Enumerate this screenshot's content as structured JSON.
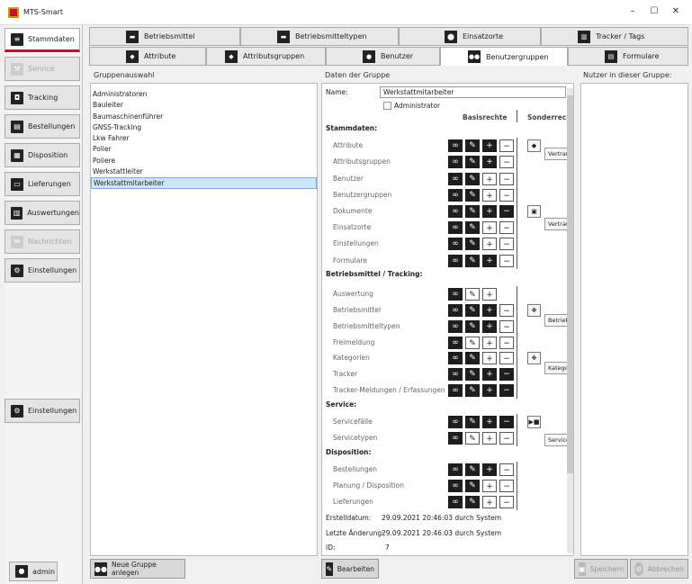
{
  "window": {
    "title": "MTS-Smart",
    "min": "–",
    "max": "☐",
    "close": "✕"
  },
  "sidebar": {
    "items": [
      {
        "label": "Stammdaten",
        "icon": "list-icon",
        "active": true
      },
      {
        "label": "Service",
        "icon": "wrench-icon",
        "disabled": true
      },
      {
        "label": "Tracking",
        "icon": "tracking-icon"
      },
      {
        "label": "Bestellungen",
        "icon": "order-icon"
      },
      {
        "label": "Disposition",
        "icon": "disposition-icon"
      },
      {
        "label": "Lieferungen",
        "icon": "delivery-icon"
      },
      {
        "label": "Auswertungen",
        "icon": "chart-icon"
      },
      {
        "label": "Nachrichten",
        "icon": "mail-icon",
        "disabled": true
      },
      {
        "label": "Einstellungen",
        "icon": "gear-icon"
      }
    ],
    "settings": "Einstellungen",
    "user": "admin"
  },
  "tabs_row1": [
    {
      "label": "Betriebsmittel"
    },
    {
      "label": "Betriebsmitteltypen"
    },
    {
      "label": "Einsatzorte"
    },
    {
      "label": "Tracker / Tags"
    }
  ],
  "tabs_row2": [
    {
      "label": "Attribute"
    },
    {
      "label": "Attributsgruppen"
    },
    {
      "label": "Benutzer"
    },
    {
      "label": "Benutzergruppen"
    },
    {
      "label": "Formulare"
    }
  ],
  "groups": {
    "header": "Gruppenauswahl",
    "items": [
      "Administratoren",
      "Bauleiter",
      "Baumaschinenführer",
      "GNSS-Tracking",
      "Lkw Fahrer",
      "Polier",
      "Poliere",
      "Werkstattleiter",
      "Werkstattmitarbeiter"
    ],
    "selected": 8,
    "new_button": "Neue Gruppe anlegen"
  },
  "details": {
    "header": "Daten der Gruppe",
    "name_label": "Name:",
    "name_value": "Werkstattmitarbeiter",
    "admin_label": "Administrator",
    "col_basic": "Basisrechte",
    "col_special": "Sonderrech",
    "sections": [
      {
        "title": "Stammdaten:",
        "rows": [
          "Attribute",
          "Attributsgruppen",
          "Benutzer",
          "Benutzergruppen",
          "Dokumente",
          "Einsatzorte",
          "Einstellungen",
          "Formulare"
        ]
      },
      {
        "title": "Betriebsmittel / Tracking:",
        "rows": [
          "Auswertung",
          "Betriebsmittel",
          "Betriebsmitteltypen",
          "Freimeldung",
          "Kategorien",
          "Tracker",
          "Tracker-Meldungen / Erfassungen"
        ]
      },
      {
        "title": "Service:",
        "rows": [
          "Servicefälle",
          "Servicetypen"
        ]
      },
      {
        "title": "Disposition:",
        "rows": [
          "Bestellungen",
          "Planung / Disposition",
          "Lieferungen"
        ]
      }
    ],
    "tooltips": [
      "Vertrauliche Attribute",
      "Vertrauliche Dokumente",
      "Betriebsmittel verschieben",
      "Kategorie verschieben",
      "Service starten/abschließen"
    ],
    "created_label": "Erstelldatum:",
    "created_value": "29.09.2021 20:46:03 durch System",
    "changed_label": "Letzte Änderung:",
    "changed_value": "29.09.2021 20:46:03 durch System",
    "id_label": "ID:",
    "id_value": "7",
    "edit_button": "Bearbeiten"
  },
  "members": {
    "header": "Nutzer in dieser Gruppe:"
  },
  "footer": {
    "save": "Speichern",
    "cancel": "Abbrechen"
  }
}
